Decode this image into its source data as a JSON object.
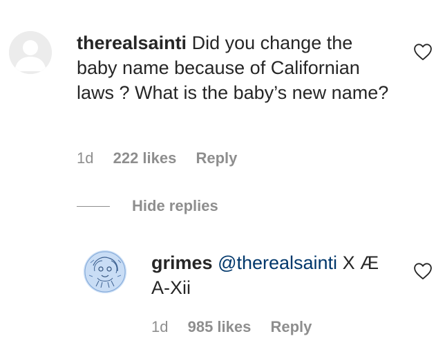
{
  "comment": {
    "username": "therealsainti",
    "text": "Did you change the baby name because of Californian laws ? What is the baby’s new name?",
    "time": "1d",
    "likes": "222 likes",
    "reply_label": "Reply",
    "avatar_icon": "default-avatar-icon",
    "like_icon": "heart-outline-icon"
  },
  "hide_replies": {
    "label": "Hide replies"
  },
  "reply": {
    "username": "grimes",
    "mention": "@therealsainti",
    "text": "X Æ A-Xii",
    "time": "1d",
    "likes": "985 likes",
    "reply_label": "Reply",
    "avatar_icon": "sketch-avatar-icon",
    "like_icon": "heart-outline-icon"
  },
  "colors": {
    "text": "#262626",
    "secondary": "#8e8e8e",
    "mention": "#00376b"
  }
}
